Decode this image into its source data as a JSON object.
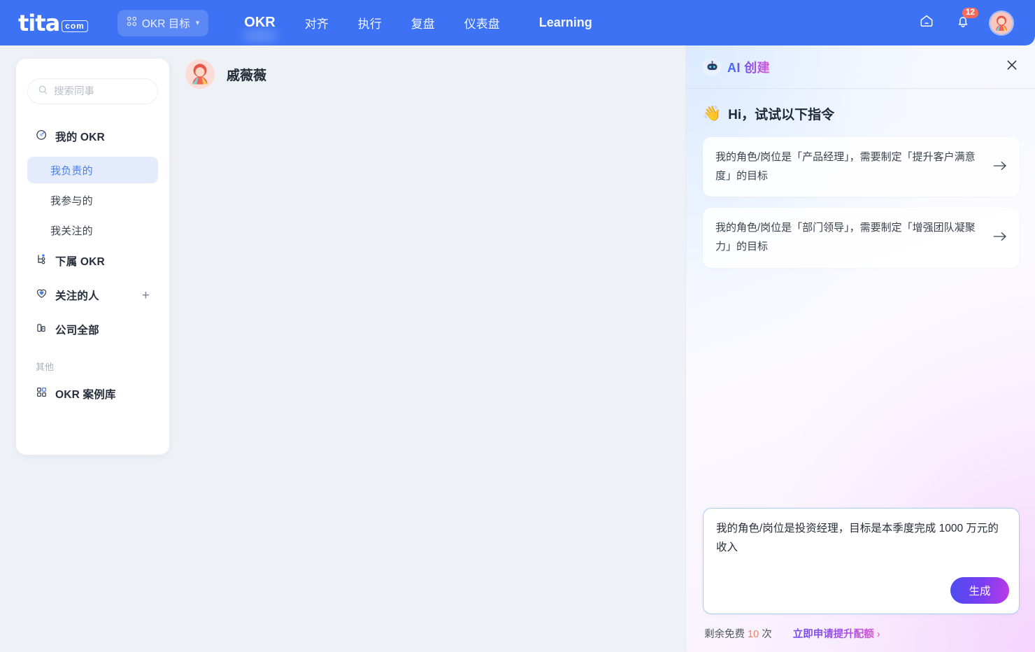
{
  "topnav": {
    "logo_word": "tita",
    "logo_suffix": "com",
    "module_pill": {
      "label": "OKR 目标",
      "icon": "grid-icon",
      "chevron": "chevron-down-icon"
    },
    "items": [
      {
        "label": "OKR",
        "active": true
      },
      {
        "label": "对齐",
        "active": false
      },
      {
        "label": "执行",
        "active": false
      },
      {
        "label": "复盘",
        "active": false
      },
      {
        "label": "仪表盘",
        "active": false
      },
      {
        "label": "Learning",
        "active": false
      }
    ],
    "home_icon": "home-icon",
    "bell_icon": "bell-icon",
    "notification_count": "12",
    "avatar": "user-avatar"
  },
  "sidebar": {
    "search": {
      "placeholder": "搜索同事",
      "value": "",
      "icon": "search-icon"
    },
    "items": [
      {
        "label": "我的 OKR",
        "icon": "target-icon",
        "type": "group"
      },
      {
        "label": "我负责的",
        "type": "sub",
        "active": true
      },
      {
        "label": "我参与的",
        "type": "sub",
        "active": false
      },
      {
        "label": "我关注的",
        "type": "sub",
        "active": false
      },
      {
        "label": "下属 OKR",
        "icon": "org-tree-icon",
        "type": "group"
      },
      {
        "label": "关注的人",
        "icon": "heart-icon",
        "type": "group",
        "action": "+"
      },
      {
        "label": "公司全部",
        "icon": "building-icon",
        "type": "group"
      }
    ],
    "section_label": "其他",
    "other_items": [
      {
        "label": "OKR 案例库",
        "icon": "grid-four-icon"
      }
    ]
  },
  "main": {
    "person_name": "戚薇薇"
  },
  "ai_panel": {
    "title": "AI 创建",
    "bot_icon": "robot-icon",
    "close_icon": "close-icon",
    "greeting_emoji": "👋",
    "greeting": "Hi，试试以下指令",
    "suggestions": [
      {
        "text": "我的角色/岗位是「产品经理」，需要制定「提升客户满意度」的目标",
        "arrow": "arrow-right-icon"
      },
      {
        "text": "我的角色/岗位是「部门领导」，需要制定「增强团队凝聚力」的目标",
        "arrow": "arrow-right-icon"
      }
    ],
    "composer": {
      "value": "我的角色/岗位是投资经理，目标是本季度完成 1000 万元的收入",
      "generate_label": "生成"
    },
    "quota": {
      "prefix": "剩余免费",
      "count": "10",
      "suffix": "次",
      "link": "立即申请提升配额",
      "link_chevron": "›"
    }
  }
}
